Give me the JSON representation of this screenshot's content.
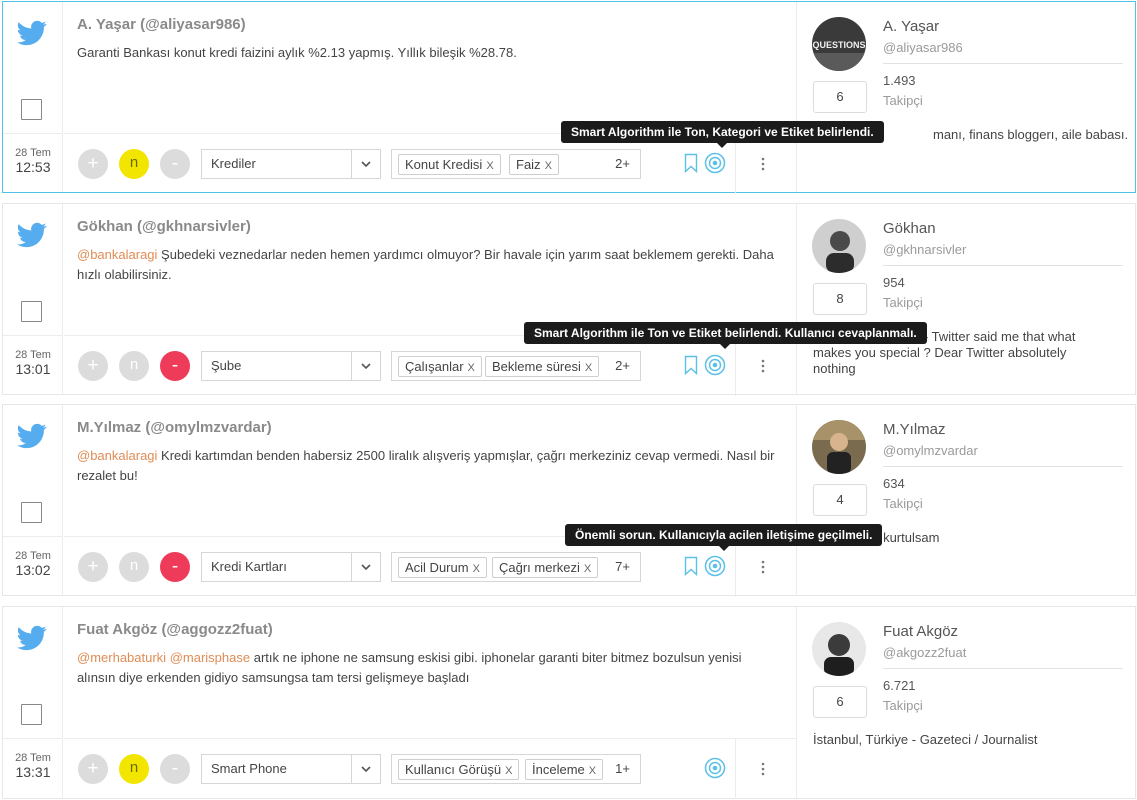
{
  "posts": [
    {
      "author": "A. Yaşar (@aliyasar986)",
      "mentions": [],
      "text": "Garanti Bankası konut kredi faizini aylık %2.13 yapmış. Yıllık bileşik %28.78.",
      "date": "28 Tem",
      "time": "12:53",
      "btn_plus": "+",
      "btn_neutral": "n",
      "btn_minus": "-",
      "active_tone": "neutral",
      "category": "Krediler",
      "tags": [
        "Konut Kredisi",
        "Faiz"
      ],
      "tag_remove": "X",
      "more_tags": "2+",
      "tooltip": "Smart Algorithm ile Ton, Kategori ve Etiket belirlendi.",
      "profile": {
        "name": "A. Yaşar",
        "handle": "@aliyasar986",
        "count": "6",
        "followers": "1.493",
        "followers_label": "Takipçi",
        "bio": "manı, finans bloggerı, aile babası."
      }
    },
    {
      "author": "Gökhan (@gkhnarsivler)",
      "mentions": [
        "@bankalaragi"
      ],
      "text": "Şubedeki veznedarlar neden hemen yardımcı olmuyor? Bir havale için yarım saat beklemem gerekti. Daha hızlı olabilirsiniz.",
      "date": "28 Tem",
      "time": "13:01",
      "btn_plus": "+",
      "btn_neutral": "n",
      "btn_minus": "-",
      "active_tone": "negative",
      "category": "Şube",
      "tags": [
        "Çalışanlar",
        "Bekleme süresi"
      ],
      "tag_remove": "X",
      "more_tags": "2+",
      "tooltip": "Smart Algorithm ile Ton ve Etiket belirlendi. Kullanıcı cevaplanmalı.",
      "profile": {
        "name": "Gökhan",
        "handle": "@gkhnarsivler",
        "count": "8",
        "followers": "954",
        "followers_label": "Takipçi",
        "bio": "bul - Twitter said me that what makes you special ? Dear Twitter absolutely nothing"
      }
    },
    {
      "author": "M.Yılmaz (@omylmzvardar)",
      "mentions": [
        "@bankalaragi"
      ],
      "text": "Kredi kartımdan benden habersiz 2500 liralık alışveriş yapmışlar, çağrı merkeziniz cevap vermedi. Nasıl bir rezalet bu!",
      "date": "28 Tem",
      "time": "13:02",
      "btn_plus": "+",
      "btn_neutral": "n",
      "btn_minus": "-",
      "active_tone": "negative",
      "category": "Kredi Kartları",
      "tags": [
        "Acil Durum",
        "Çağrı merkezi"
      ],
      "tag_remove": "X",
      "more_tags": "7+",
      "tooltip": "Önemli sorun. Kullanıcıyla acilen iletişime geçilmeli.",
      "profile": {
        "name": "M.Yılmaz",
        "handle": "@omylmzvardar",
        "count": "4",
        "followers": "634",
        "followers_label": "Takipçi",
        "bio": "de kurtulsam"
      }
    },
    {
      "author": "Fuat Akgöz (@aggozz2fuat)",
      "mentions": [
        "@merhabaturki",
        "@marisphase"
      ],
      "text": "artık ne iphone ne samsung eskisi gibi. iphonelar garanti biter bitmez bozulsun yenisi alınsın diye erkenden gidiyo samsungsa  tam tersi gelişmeye başladı",
      "date": "28 Tem",
      "time": "13:31",
      "btn_plus": "+",
      "btn_neutral": "n",
      "btn_minus": "-",
      "active_tone": "neutral",
      "category": "Smart Phone",
      "tags": [
        "Kullanıcı Görüşü",
        "İnceleme"
      ],
      "tag_remove": "X",
      "more_tags": "1+",
      "tooltip": "",
      "profile": {
        "name": "Fuat Akgöz",
        "handle": "@akgozz2fuat",
        "count": "6",
        "followers": "6.721",
        "followers_label": "Takipçi",
        "bio": "İstanbul, Türkiye - Gazeteci / Journalist"
      }
    }
  ],
  "colors": {
    "twitter_blue": "#55acee",
    "active_border": "#4fc3e6",
    "neutral_yellow": "#f2e600",
    "negative_red": "#ef3b5a",
    "mention": "#e08c55",
    "icon_blue": "#5bc0e8"
  },
  "icons": {
    "source": "twitter-bird-icon",
    "bookmark": "bookmark-icon",
    "smart": "target-icon",
    "menu": "vertical-dots-icon",
    "dropdown": "chevron-down-icon",
    "avatar_1_text": "QUESTIONS"
  }
}
